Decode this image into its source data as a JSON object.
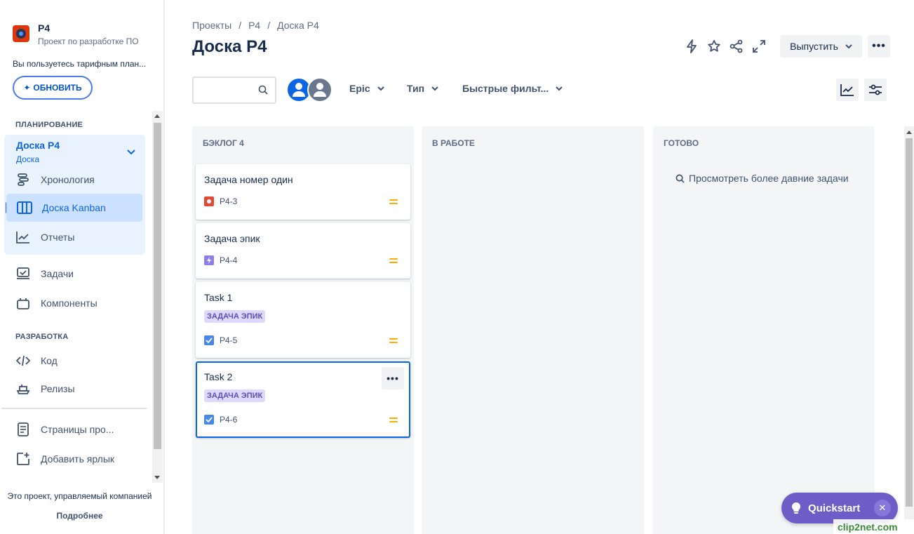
{
  "project": {
    "name": "P4",
    "subtitle": "Проект по разработке ПО"
  },
  "plan_note": "Вы пользуетесь тарифным план...",
  "upgrade_label": "ОБНОВИТЬ",
  "sidebar": {
    "planning_title": "ПЛАНИРОВАНИЕ",
    "board_title": "Доска P4",
    "board_sub": "Доска",
    "items": [
      {
        "label": "Хронология"
      },
      {
        "label": "Доска Kanban"
      },
      {
        "label": "Отчеты"
      },
      {
        "label": "Задачи"
      },
      {
        "label": "Компоненты"
      }
    ],
    "dev_title": "РАЗРАБОТКА",
    "dev_items": [
      {
        "label": "Код"
      },
      {
        "label": "Релизы"
      }
    ],
    "extra_items": [
      {
        "label": "Страницы про..."
      },
      {
        "label": "Добавить ярлык"
      }
    ],
    "footer_note": "Это проект, управляемый компанией",
    "footer_link": "Подробнее"
  },
  "breadcrumb": [
    "Проекты",
    "/",
    "P4",
    "/",
    "Доска P4"
  ],
  "page_title": "Доска P4",
  "release_label": "Выпустить",
  "filters": {
    "epic": "Epic",
    "type": "Тип",
    "quick": "Быстрые фильт..."
  },
  "columns": [
    {
      "title": "БЭКЛОГ 4"
    },
    {
      "title": "В РАБОТЕ"
    },
    {
      "title": "ГОТОВО"
    }
  ],
  "cards": [
    {
      "title": "Задача номер один",
      "key": "P4-3",
      "type": "bug",
      "epic": ""
    },
    {
      "title": "Задача эпик",
      "key": "P4-4",
      "type": "epic",
      "epic": ""
    },
    {
      "title": "Task 1",
      "key": "P4-5",
      "type": "task",
      "epic": "ЗАДАЧА ЭПИК"
    },
    {
      "title": "Task 2",
      "key": "P4-6",
      "type": "task",
      "epic": "ЗАДАЧА ЭПИК"
    }
  ],
  "older_tasks": "Просмотреть более давние задачи",
  "quickstart": "Quickstart",
  "watermark": "clip2net.com",
  "colors": {
    "accent": "#0c66e4",
    "bug": "#e34935",
    "epic": "#8f7ee7",
    "task": "#4688ec",
    "priority": "#ffab00",
    "quickstart": "#6e5dc6"
  }
}
